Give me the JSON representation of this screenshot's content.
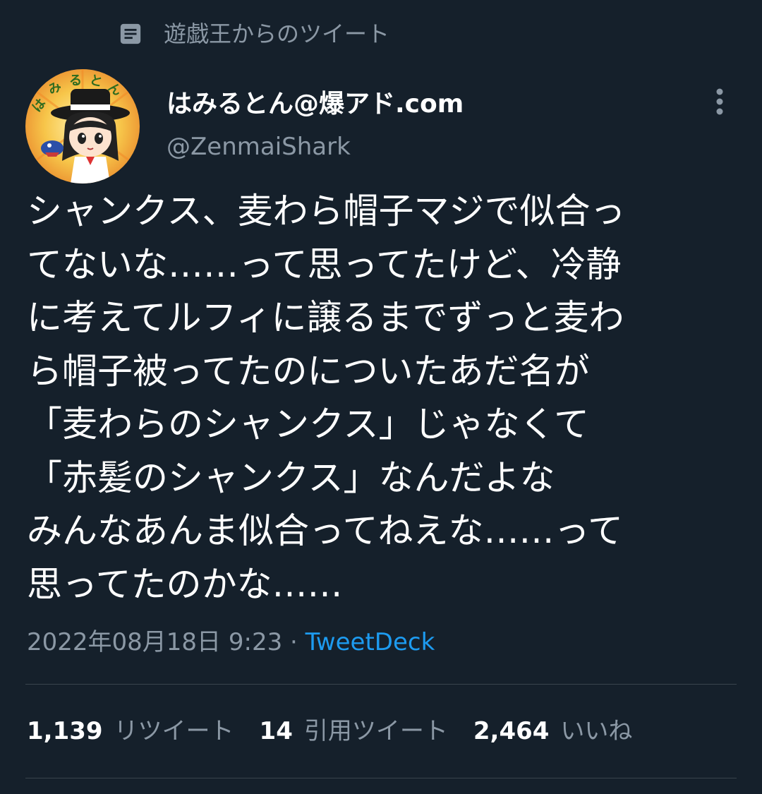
{
  "context": {
    "label": "遊戯王からのツイート",
    "icon": "topic-list-icon"
  },
  "author": {
    "name": "はみるとん@爆アド.com",
    "handle": "@ZenmaiShark",
    "avatar_text": "はみるとん"
  },
  "more_icon": "more-vertical-icon",
  "tweet": {
    "lines": [
      "シャンクス、麦わら帽子マジで似合っ",
      "てないな……って思ってたけど、冷静",
      "に考えてルフィに譲るまでずっと麦わ",
      "ら帽子被ってたのについたあだ名が",
      "「麦わらのシャンクス」じゃなくて",
      "「赤髪のシャンクス」なんだよな",
      "みんなあんま似合ってねえな……って",
      "思ってたのかな……"
    ]
  },
  "meta": {
    "timestamp": "2022年08月18日 9:23",
    "separator": " · ",
    "source": "TweetDeck"
  },
  "stats": {
    "retweets": {
      "count": "1,139",
      "label": "リツイート"
    },
    "quotes": {
      "count": "14",
      "label": "引用ツイート"
    },
    "likes": {
      "count": "2,464",
      "label": "いいね"
    }
  },
  "colors": {
    "background": "#15202b",
    "text": "#ffffff",
    "secondary": "#8b98a5",
    "link": "#1d9bf0",
    "divider": "#38444d"
  }
}
